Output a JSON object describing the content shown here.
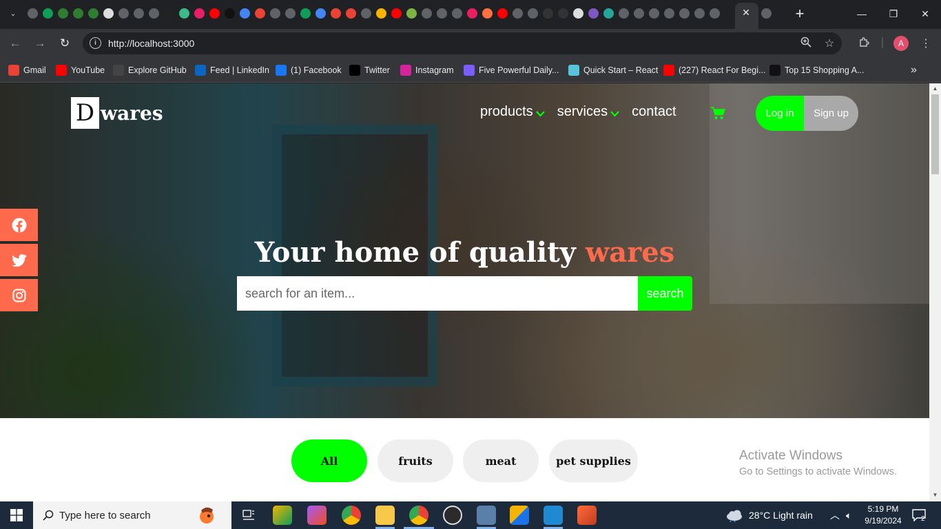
{
  "browser": {
    "address_url": "http://localhost:3000",
    "bookmarks": [
      {
        "label": "Gmail",
        "icon": "gmail-icon",
        "color": "#ea4335"
      },
      {
        "label": "YouTube",
        "icon": "youtube-icon",
        "color": "#ff0000"
      },
      {
        "label": "Explore GitHub",
        "icon": "github-icon",
        "color": "#444444"
      },
      {
        "label": "Feed | LinkedIn",
        "icon": "linkedin-icon",
        "color": "#0a66c2"
      },
      {
        "label": "(1) Facebook",
        "icon": "facebook-icon",
        "color": "#1877f2"
      },
      {
        "label": "Twitter",
        "icon": "x-icon",
        "color": "#000000"
      },
      {
        "label": "Instagram",
        "icon": "instagram-icon",
        "color": "#d6249f"
      },
      {
        "label": "Five Powerful Daily...",
        "icon": "bookmark-icon",
        "color": "#7b5cff"
      },
      {
        "label": "Quick Start – React",
        "icon": "react-icon",
        "color": "#58c4dc"
      },
      {
        "label": "(227) React For Begi...",
        "icon": "youtube-icon",
        "color": "#ff0000"
      },
      {
        "label": "Top 15 Shopping A...",
        "icon": "pa-icon",
        "color": "#111111"
      }
    ]
  },
  "site": {
    "logo_letter": "D",
    "logo_text": "wares",
    "nav": {
      "products": "products",
      "services": "services",
      "contact": "contact"
    },
    "login_label": "Log in",
    "signup_label": "Sign up",
    "headline_main": "Your home of quality",
    "headline_accent": "wares",
    "search_placeholder": "search for an item...",
    "search_button": "search",
    "filters": [
      "All",
      "fruits",
      "meat",
      "pet supplies"
    ],
    "active_filter": "All",
    "social": [
      "facebook-icon",
      "twitter-icon",
      "instagram-icon"
    ]
  },
  "colors": {
    "accent_green": "#00ff00",
    "accent_coral": "#ff6a4d",
    "signup_gray": "#a9a9a9"
  },
  "watermark": {
    "title": "Activate Windows",
    "subtitle": "Go to Settings to activate Windows."
  },
  "taskbar": {
    "search_placeholder": "Type here to search",
    "weather": "28°C  Light rain",
    "time": "5:19 PM",
    "date": "9/19/2024",
    "notifications": "2"
  }
}
